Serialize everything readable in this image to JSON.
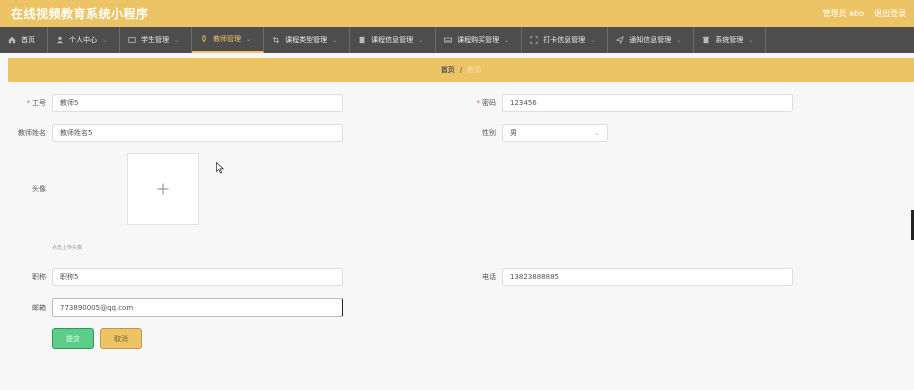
{
  "header": {
    "title": "在线视频教育系统小程序",
    "user_label": "管理员 abo",
    "logout_label": "退出登录",
    "accent": "#ecc466"
  },
  "nav": {
    "items": [
      {
        "label": "首页",
        "icon": "home-icon",
        "active": false
      },
      {
        "label": "个人中心",
        "icon": "person-icon",
        "active": false
      },
      {
        "label": "学生管理",
        "icon": "card-icon",
        "active": false
      },
      {
        "label": "教师管理",
        "icon": "pin-icon",
        "active": true
      },
      {
        "label": "课程类型管理",
        "icon": "crop-icon",
        "active": false
      },
      {
        "label": "课程信息管理",
        "icon": "book-icon",
        "active": false
      },
      {
        "label": "课程购买管理",
        "icon": "keyboard-icon",
        "active": false
      },
      {
        "label": "打卡信息管理",
        "icon": "frame-icon",
        "active": false
      },
      {
        "label": "通知信息管理",
        "icon": "send-icon",
        "active": false
      },
      {
        "label": "系统管理",
        "icon": "trash-icon",
        "active": false
      }
    ]
  },
  "breadcrumb": {
    "home": "首页",
    "separator": "/",
    "current": "教师"
  },
  "form": {
    "job_no": {
      "label": "工号",
      "value": "教师5"
    },
    "password": {
      "label": "密码",
      "value": "123456"
    },
    "teacher_name": {
      "label": "教师姓名",
      "value": "教师姓名5"
    },
    "gender": {
      "label": "性别",
      "value": "男"
    },
    "avatar": {
      "label": "头像",
      "hint": "点击上传头像"
    },
    "title": {
      "label": "职称",
      "value": "职称5"
    },
    "phone": {
      "label": "电话",
      "value": "13823888885"
    },
    "email": {
      "label": "邮箱",
      "value": "773890005@qq.com"
    }
  },
  "buttons": {
    "submit": "提交",
    "cancel": "取消"
  }
}
